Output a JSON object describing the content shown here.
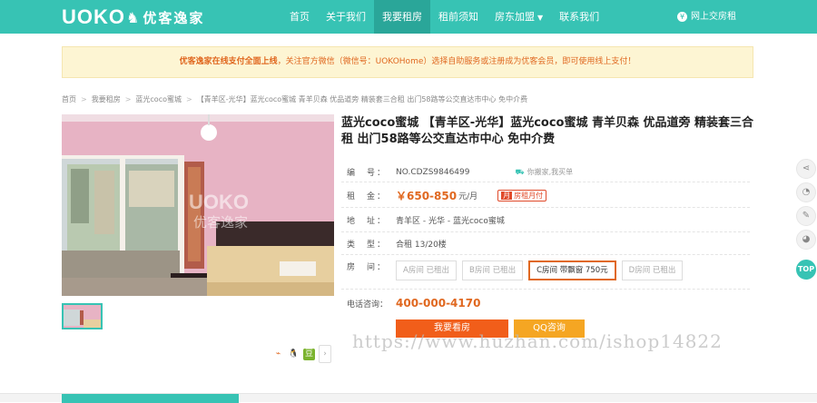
{
  "header": {
    "logo_mark": "UOKO",
    "logo_cn": "优客逸家",
    "nav": [
      {
        "label": "首页",
        "active": false
      },
      {
        "label": "关于我们",
        "active": false
      },
      {
        "label": "我要租房",
        "active": true
      },
      {
        "label": "租前须知",
        "active": false
      },
      {
        "label": "房东加盟",
        "active": false,
        "dropdown": true
      },
      {
        "label": "联系我们",
        "active": false
      }
    ],
    "pay_online": "网上交房租"
  },
  "notice": {
    "highlight": "优客逸家在线支付全面上线",
    "text": "，关注官方微信（微信号：UOKOHome）选择自助服务或注册成为优客会员，即可使用线上支付！"
  },
  "breadcrumb": [
    "首页",
    "我要租房",
    "蓝光coco蜜城",
    "【青羊区-光华】蓝光coco蜜城 青羊贝森 优品道旁 精装套三合租 出门58路等公交直达市中心 免中介费"
  ],
  "listing": {
    "title": "蓝光coco蜜城 【青羊区-光华】蓝光coco蜜城 青羊贝森 优品道旁 精装套三合租 出门58路等公交直达市中心 免中介费",
    "photo_watermark_mark": "UOKO",
    "photo_watermark_cn": "优客逸家",
    "fields": {
      "code_label": "编　号：",
      "code_value": "NO.CDZS9846499",
      "eligibility": "你搬家,我买单",
      "rent_label": "租　金：",
      "rent_value": "￥650-850",
      "rent_unit": "元/月",
      "rent_tag_badge": "月",
      "rent_tag": "房租月付",
      "address_label": "地　址：",
      "address_value": "青羊区 - 光华 - 蓝光coco蜜城",
      "type_label": "类　型：",
      "type_value": "合租 13/20楼",
      "room_label": "房　间：",
      "rooms": [
        {
          "label": "A房间 已租出",
          "selected": false
        },
        {
          "label": "B房间 已租出",
          "selected": false
        },
        {
          "label": "C房间 带飘窗 750元",
          "selected": true
        },
        {
          "label": "D房间 已租出",
          "selected": false
        }
      ],
      "phone_label": "电话咨询：",
      "phone_value": "400-000-4170"
    },
    "actions": {
      "view_button": "我要看房",
      "qq_button": "QQ咨询"
    }
  },
  "side_tools": {
    "top_label": "TOP"
  },
  "watermark": "https://www.huzhan.com/ishop14822",
  "colors": {
    "brand_teal": "#37c3b4",
    "accent_orange": "#e06820",
    "view_button": "#f15e1a",
    "qq_button": "#f5a623"
  }
}
